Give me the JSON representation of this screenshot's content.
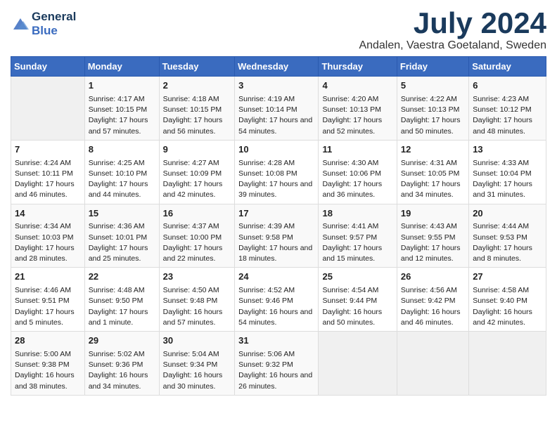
{
  "header": {
    "logo_line1": "General",
    "logo_line2": "Blue",
    "month": "July 2024",
    "location": "Andalen, Vaestra Goetaland, Sweden"
  },
  "weekdays": [
    "Sunday",
    "Monday",
    "Tuesday",
    "Wednesday",
    "Thursday",
    "Friday",
    "Saturday"
  ],
  "weeks": [
    [
      {
        "day": "",
        "empty": true
      },
      {
        "day": "1",
        "sunrise": "4:17 AM",
        "sunset": "10:15 PM",
        "daylight": "17 hours and 57 minutes."
      },
      {
        "day": "2",
        "sunrise": "4:18 AM",
        "sunset": "10:15 PM",
        "daylight": "17 hours and 56 minutes."
      },
      {
        "day": "3",
        "sunrise": "4:19 AM",
        "sunset": "10:14 PM",
        "daylight": "17 hours and 54 minutes."
      },
      {
        "day": "4",
        "sunrise": "4:20 AM",
        "sunset": "10:13 PM",
        "daylight": "17 hours and 52 minutes."
      },
      {
        "day": "5",
        "sunrise": "4:22 AM",
        "sunset": "10:13 PM",
        "daylight": "17 hours and 50 minutes."
      },
      {
        "day": "6",
        "sunrise": "4:23 AM",
        "sunset": "10:12 PM",
        "daylight": "17 hours and 48 minutes."
      }
    ],
    [
      {
        "day": "7",
        "sunrise": "4:24 AM",
        "sunset": "10:11 PM",
        "daylight": "17 hours and 46 minutes."
      },
      {
        "day": "8",
        "sunrise": "4:25 AM",
        "sunset": "10:10 PM",
        "daylight": "17 hours and 44 minutes."
      },
      {
        "day": "9",
        "sunrise": "4:27 AM",
        "sunset": "10:09 PM",
        "daylight": "17 hours and 42 minutes."
      },
      {
        "day": "10",
        "sunrise": "4:28 AM",
        "sunset": "10:08 PM",
        "daylight": "17 hours and 39 minutes."
      },
      {
        "day": "11",
        "sunrise": "4:30 AM",
        "sunset": "10:06 PM",
        "daylight": "17 hours and 36 minutes."
      },
      {
        "day": "12",
        "sunrise": "4:31 AM",
        "sunset": "10:05 PM",
        "daylight": "17 hours and 34 minutes."
      },
      {
        "day": "13",
        "sunrise": "4:33 AM",
        "sunset": "10:04 PM",
        "daylight": "17 hours and 31 minutes."
      }
    ],
    [
      {
        "day": "14",
        "sunrise": "4:34 AM",
        "sunset": "10:03 PM",
        "daylight": "17 hours and 28 minutes."
      },
      {
        "day": "15",
        "sunrise": "4:36 AM",
        "sunset": "10:01 PM",
        "daylight": "17 hours and 25 minutes."
      },
      {
        "day": "16",
        "sunrise": "4:37 AM",
        "sunset": "10:00 PM",
        "daylight": "17 hours and 22 minutes."
      },
      {
        "day": "17",
        "sunrise": "4:39 AM",
        "sunset": "9:58 PM",
        "daylight": "17 hours and 18 minutes."
      },
      {
        "day": "18",
        "sunrise": "4:41 AM",
        "sunset": "9:57 PM",
        "daylight": "17 hours and 15 minutes."
      },
      {
        "day": "19",
        "sunrise": "4:43 AM",
        "sunset": "9:55 PM",
        "daylight": "17 hours and 12 minutes."
      },
      {
        "day": "20",
        "sunrise": "4:44 AM",
        "sunset": "9:53 PM",
        "daylight": "17 hours and 8 minutes."
      }
    ],
    [
      {
        "day": "21",
        "sunrise": "4:46 AM",
        "sunset": "9:51 PM",
        "daylight": "17 hours and 5 minutes."
      },
      {
        "day": "22",
        "sunrise": "4:48 AM",
        "sunset": "9:50 PM",
        "daylight": "17 hours and 1 minute."
      },
      {
        "day": "23",
        "sunrise": "4:50 AM",
        "sunset": "9:48 PM",
        "daylight": "16 hours and 57 minutes."
      },
      {
        "day": "24",
        "sunrise": "4:52 AM",
        "sunset": "9:46 PM",
        "daylight": "16 hours and 54 minutes."
      },
      {
        "day": "25",
        "sunrise": "4:54 AM",
        "sunset": "9:44 PM",
        "daylight": "16 hours and 50 minutes."
      },
      {
        "day": "26",
        "sunrise": "4:56 AM",
        "sunset": "9:42 PM",
        "daylight": "16 hours and 46 minutes."
      },
      {
        "day": "27",
        "sunrise": "4:58 AM",
        "sunset": "9:40 PM",
        "daylight": "16 hours and 42 minutes."
      }
    ],
    [
      {
        "day": "28",
        "sunrise": "5:00 AM",
        "sunset": "9:38 PM",
        "daylight": "16 hours and 38 minutes."
      },
      {
        "day": "29",
        "sunrise": "5:02 AM",
        "sunset": "9:36 PM",
        "daylight": "16 hours and 34 minutes."
      },
      {
        "day": "30",
        "sunrise": "5:04 AM",
        "sunset": "9:34 PM",
        "daylight": "16 hours and 30 minutes."
      },
      {
        "day": "31",
        "sunrise": "5:06 AM",
        "sunset": "9:32 PM",
        "daylight": "16 hours and 26 minutes."
      },
      {
        "day": "",
        "empty": true
      },
      {
        "day": "",
        "empty": true
      },
      {
        "day": "",
        "empty": true
      }
    ]
  ]
}
